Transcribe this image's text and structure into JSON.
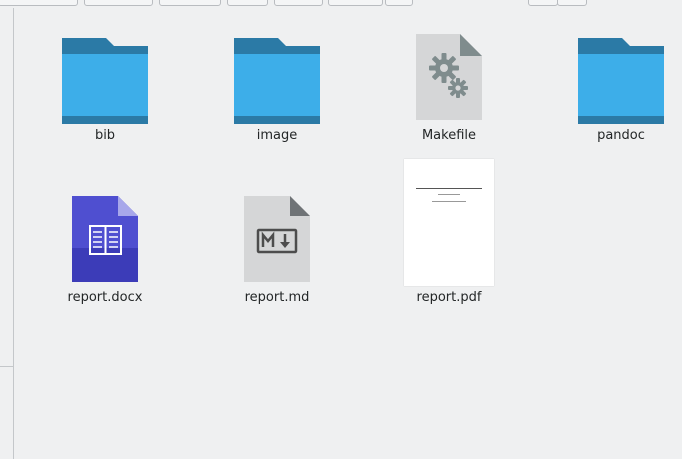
{
  "files": [
    {
      "name": "bib",
      "kind": "folder"
    },
    {
      "name": "image",
      "kind": "folder"
    },
    {
      "name": "Makefile",
      "kind": "makefile"
    },
    {
      "name": "pandoc",
      "kind": "folder"
    },
    {
      "name": "report.docx",
      "kind": "docx"
    },
    {
      "name": "report.md",
      "kind": "markdown"
    },
    {
      "name": "report.pdf",
      "kind": "pdf"
    }
  ],
  "colors": {
    "folder_front": "#3daee9",
    "folder_back": "#2b7aa6",
    "docx": "#4f4fd0",
    "generic_file": "#d0d0d0",
    "label_text": "#232627"
  }
}
